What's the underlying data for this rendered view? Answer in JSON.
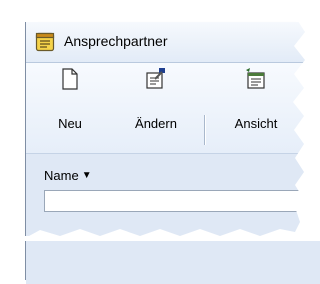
{
  "window": {
    "title": "Ansprechpartner",
    "title_icon": "notepad-icon"
  },
  "toolbar": {
    "buttons": [
      {
        "label": "Neu",
        "icon": "new-document-icon"
      },
      {
        "label": "Ändern",
        "icon": "edit-document-icon"
      },
      {
        "label": "Ansicht",
        "icon": "view-icon"
      }
    ]
  },
  "filter": {
    "column_label": "Name",
    "sort_indicator": "▼",
    "value": ""
  },
  "colors": {
    "window_bg": "#dfe9f6",
    "toolbar_bg": "#eef3fb",
    "title_icon_fill": "#f5d34a"
  }
}
